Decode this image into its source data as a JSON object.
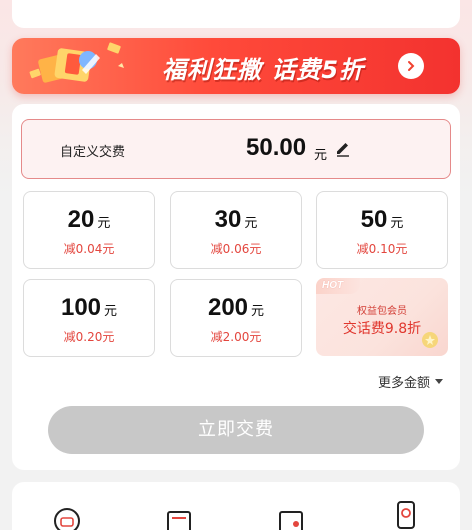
{
  "promo_banner": {
    "text": "福利狂撒 话费5折",
    "colors": {
      "start": "#ff7a5c",
      "end": "#f3322f"
    }
  },
  "custom_amount": {
    "label": "自定义交费",
    "value": "50.00",
    "unit": "元"
  },
  "options": [
    {
      "amount": "20",
      "unit": "元",
      "discount": "减0.04元"
    },
    {
      "amount": "30",
      "unit": "元",
      "discount": "减0.06元"
    },
    {
      "amount": "50",
      "unit": "元",
      "discount": "减0.10元"
    },
    {
      "amount": "100",
      "unit": "元",
      "discount": "减0.20元"
    },
    {
      "amount": "200",
      "unit": "元",
      "discount": "减2.00元"
    }
  ],
  "vip_card": {
    "hot_badge": "HOT",
    "subtitle": "权益包会员",
    "title": "交话费9.8折"
  },
  "more_amounts": "更多金额",
  "pay_button": "立即交费",
  "bottom_icons": [
    "service-icon",
    "bill-icon",
    "card-icon",
    "phone-icon"
  ],
  "accent_color": "#e3463e"
}
